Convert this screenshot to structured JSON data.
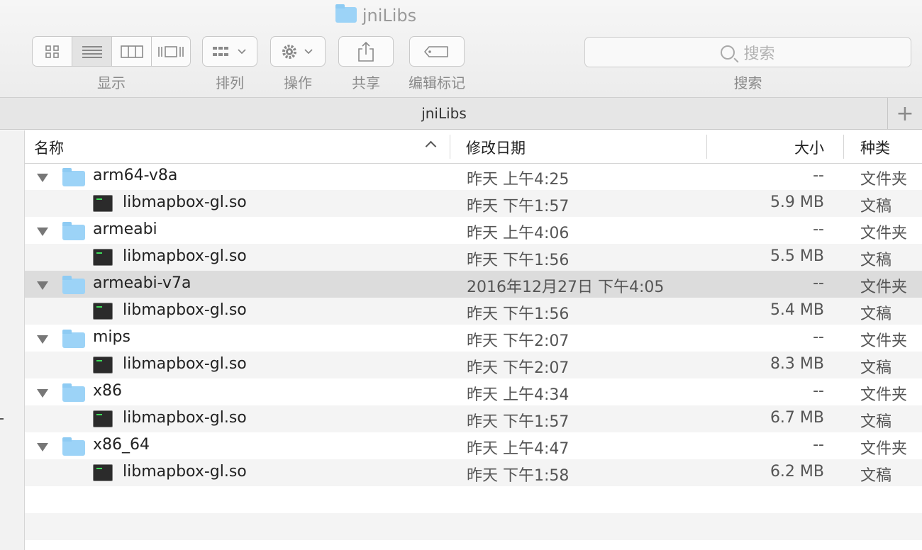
{
  "window": {
    "title": "jniLibs"
  },
  "toolbar": {
    "view_label": "显示",
    "arrange_label": "排列",
    "action_label": "操作",
    "share_label": "共享",
    "tags_label": "编辑标记",
    "search_placeholder": "搜索",
    "search_label": "搜索"
  },
  "tabbar": {
    "title": "jniLibs",
    "add": "+"
  },
  "columns": {
    "name": "名称",
    "date": "修改日期",
    "size": "大小",
    "kind": "种类"
  },
  "rows": [
    {
      "type": "folder",
      "name": "arm64-v8a",
      "date": "昨天 上午4:25",
      "size": "--",
      "kind": "文件夹"
    },
    {
      "type": "file",
      "name": "libmapbox-gl.so",
      "date": "昨天 下午1:57",
      "size": "5.9 MB",
      "kind": "文稿"
    },
    {
      "type": "folder",
      "name": "armeabi",
      "date": "昨天 上午4:06",
      "size": "--",
      "kind": "文件夹"
    },
    {
      "type": "file",
      "name": "libmapbox-gl.so",
      "date": "昨天 下午1:56",
      "size": "5.5 MB",
      "kind": "文稿"
    },
    {
      "type": "folder",
      "name": "armeabi-v7a",
      "date": "2016年12月27日 下午4:05",
      "size": "--",
      "kind": "文件夹",
      "selected": true
    },
    {
      "type": "file",
      "name": "libmapbox-gl.so",
      "date": "昨天 下午1:56",
      "size": "5.4 MB",
      "kind": "文稿"
    },
    {
      "type": "folder",
      "name": "mips",
      "date": "昨天 下午2:07",
      "size": "--",
      "kind": "文件夹"
    },
    {
      "type": "file",
      "name": "libmapbox-gl.so",
      "date": "昨天 下午2:07",
      "size": "8.3 MB",
      "kind": "文稿"
    },
    {
      "type": "folder",
      "name": "x86",
      "date": "昨天 上午4:34",
      "size": "--",
      "kind": "文件夹"
    },
    {
      "type": "file",
      "name": "libmapbox-gl.so",
      "date": "昨天 下午1:57",
      "size": "6.7 MB",
      "kind": "文稿"
    },
    {
      "type": "folder",
      "name": "x86_64",
      "date": "昨天 上午4:47",
      "size": "--",
      "kind": "文件夹"
    },
    {
      "type": "file",
      "name": "libmapbox-gl.so",
      "date": "昨天 下午1:58",
      "size": "6.2 MB",
      "kind": "文稿"
    }
  ]
}
